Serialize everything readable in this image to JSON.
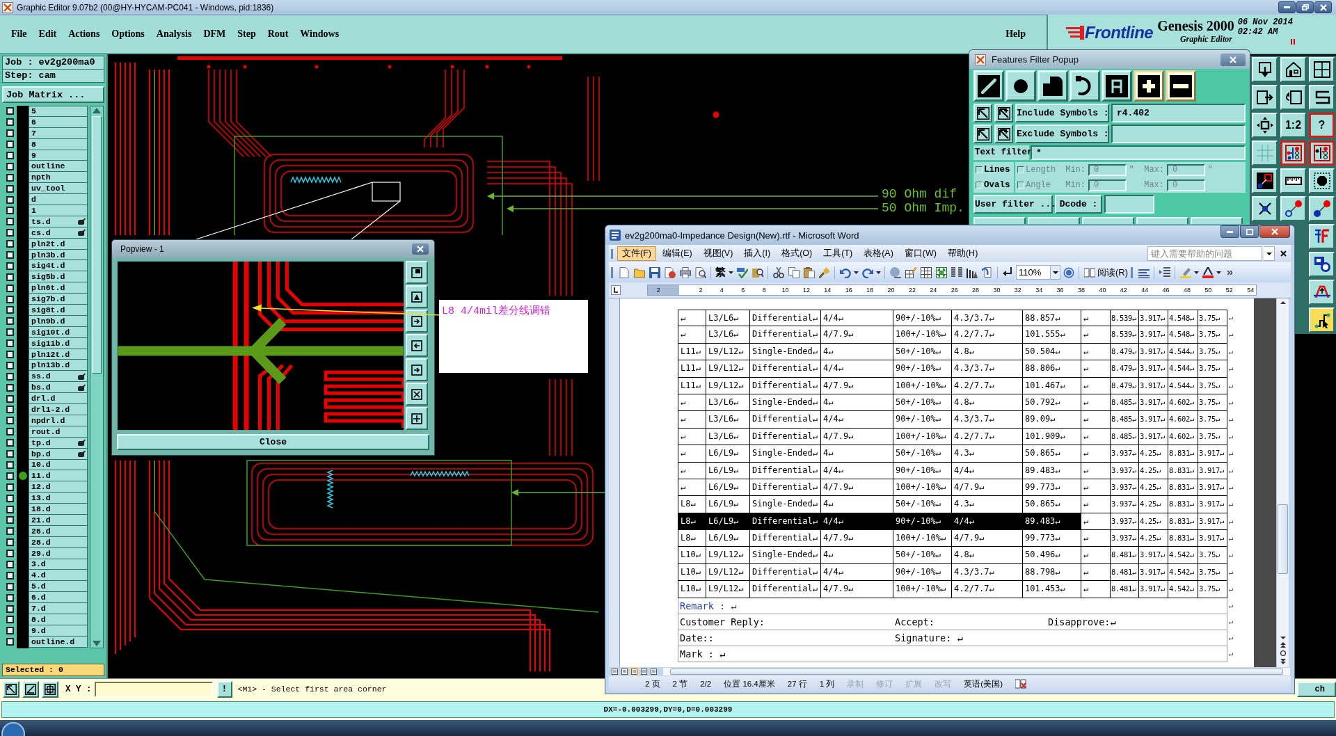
{
  "window": {
    "title": "Graphic Editor 9.07b2 (00@HY-HYCAM-PC041 - Windows, pid:1836)"
  },
  "menu_bar": {
    "items": [
      "File",
      "Edit",
      "Actions",
      "Options",
      "Analysis",
      "DFM",
      "Step",
      "Rout",
      "Windows"
    ],
    "help": "Help"
  },
  "brand": {
    "logo": "Frontline",
    "product": "Genesis 2000",
    "subtitle": "Graphic Editor",
    "date": "06 Nov 2014",
    "time": "02:42 AM"
  },
  "job_panel": {
    "job": "Job : ev2g200ma0",
    "step": "Step: cam",
    "matrix_button": "Job Matrix ...",
    "selected_count": "Selected : 0",
    "layers": [
      {
        "name": "5",
        "checked": false,
        "displayed": false,
        "flagged": false
      },
      {
        "name": "6",
        "checked": false,
        "displayed": false,
        "flagged": false
      },
      {
        "name": "7",
        "checked": false,
        "displayed": false,
        "flagged": false
      },
      {
        "name": "8",
        "checked": false,
        "displayed": false,
        "flagged": false
      },
      {
        "name": "9",
        "checked": false,
        "displayed": false,
        "flagged": false
      },
      {
        "name": "outline",
        "checked": false,
        "displayed": false,
        "flagged": false
      },
      {
        "name": "npth",
        "checked": false,
        "displayed": false,
        "flagged": false
      },
      {
        "name": "uv_tool",
        "checked": false,
        "displayed": false,
        "flagged": false
      },
      {
        "name": "d",
        "checked": false,
        "displayed": false,
        "flagged": false
      },
      {
        "name": "1",
        "checked": false,
        "displayed": false,
        "flagged": false
      },
      {
        "name": "ts.d",
        "checked": false,
        "displayed": false,
        "flagged": true
      },
      {
        "name": "cs.d",
        "checked": false,
        "displayed": false,
        "flagged": true
      },
      {
        "name": "pln2t.d",
        "checked": false,
        "displayed": false,
        "flagged": false
      },
      {
        "name": "pln3b.d",
        "checked": false,
        "displayed": false,
        "flagged": false
      },
      {
        "name": "sig4t.d",
        "checked": false,
        "displayed": false,
        "flagged": false
      },
      {
        "name": "sig5b.d",
        "checked": false,
        "displayed": false,
        "flagged": false
      },
      {
        "name": "pln6t.d",
        "checked": false,
        "displayed": false,
        "flagged": false
      },
      {
        "name": "sig7b.d",
        "checked": false,
        "displayed": false,
        "flagged": false
      },
      {
        "name": "sig8t.d",
        "checked": false,
        "displayed": false,
        "flagged": false
      },
      {
        "name": "pln9b.d",
        "checked": false,
        "displayed": false,
        "flagged": false
      },
      {
        "name": "sig10t.d",
        "checked": false,
        "displayed": false,
        "flagged": false
      },
      {
        "name": "sig11b.d",
        "checked": false,
        "displayed": false,
        "flagged": false
      },
      {
        "name": "pln12t.d",
        "checked": false,
        "displayed": false,
        "flagged": false
      },
      {
        "name": "pln13b.d",
        "checked": false,
        "displayed": false,
        "flagged": false
      },
      {
        "name": "ss.d",
        "checked": false,
        "displayed": false,
        "flagged": true
      },
      {
        "name": "bs.d",
        "checked": false,
        "displayed": false,
        "flagged": true
      },
      {
        "name": "drl.d",
        "checked": false,
        "displayed": false,
        "flagged": false
      },
      {
        "name": "drl1-2.d",
        "checked": false,
        "displayed": false,
        "flagged": false
      },
      {
        "name": "npdrl.d",
        "checked": false,
        "displayed": false,
        "flagged": false
      },
      {
        "name": "rout.d",
        "checked": false,
        "displayed": false,
        "flagged": false
      },
      {
        "name": "tp.d",
        "checked": false,
        "displayed": false,
        "flagged": true
      },
      {
        "name": "bp.d",
        "checked": false,
        "displayed": false,
        "flagged": true
      },
      {
        "name": "10.d",
        "checked": false,
        "displayed": false,
        "flagged": false
      },
      {
        "name": "11.d",
        "checked": false,
        "displayed": true,
        "flagged": false
      },
      {
        "name": "12.d",
        "checked": false,
        "displayed": false,
        "flagged": false
      },
      {
        "name": "13.d",
        "checked": false,
        "displayed": false,
        "flagged": false
      },
      {
        "name": "18.d",
        "checked": false,
        "displayed": false,
        "flagged": false
      },
      {
        "name": "21.d",
        "checked": false,
        "displayed": false,
        "flagged": false
      },
      {
        "name": "26.d",
        "checked": false,
        "displayed": false,
        "flagged": false
      },
      {
        "name": "28.d",
        "checked": false,
        "displayed": false,
        "flagged": false
      },
      {
        "name": "29.d",
        "checked": false,
        "displayed": false,
        "flagged": false
      },
      {
        "name": "3.d",
        "checked": false,
        "displayed": false,
        "flagged": false
      },
      {
        "name": "4.d",
        "checked": false,
        "displayed": false,
        "flagged": false
      },
      {
        "name": "5.d",
        "checked": false,
        "displayed": false,
        "flagged": false
      },
      {
        "name": "6.d",
        "checked": false,
        "displayed": false,
        "flagged": false
      },
      {
        "name": "7.d",
        "checked": false,
        "displayed": false,
        "flagged": false
      },
      {
        "name": "8.d",
        "checked": false,
        "displayed": false,
        "flagged": false
      },
      {
        "name": "9.d",
        "checked": false,
        "displayed": false,
        "flagged": false
      },
      {
        "name": "outline.d",
        "checked": false,
        "displayed": false,
        "flagged": false
      }
    ]
  },
  "canvas": {
    "labels": [
      "90 Ohm dif",
      "50 Ohm Imp."
    ],
    "note": "L8 4/4mil差分线调错"
  },
  "popview": {
    "title": "Popview - 1",
    "close_button": "Close"
  },
  "features_filter": {
    "title": "Features Filter Popup",
    "types": [
      {
        "on": false
      },
      {
        "on": false
      },
      {
        "on": false
      },
      {
        "on": false
      },
      {
        "on": false
      },
      {
        "on": true
      },
      {
        "on": true
      }
    ],
    "include": {
      "label": "Include Symbols :",
      "value": "r4.402"
    },
    "exclude": {
      "label": "Exclude Symbols :"
    },
    "text_filter": {
      "label": "Text filter",
      "value": "*"
    },
    "shapes": [
      {
        "label": "Lines",
        "checked": false
      },
      {
        "label": "Ovals",
        "checked": false
      }
    ],
    "ranges": [
      {
        "label": "Length",
        "checked": false,
        "disabled": true,
        "min_label": "Min:",
        "min": "0",
        "max_label": "Max:",
        "max": "0",
        "unit": "\""
      },
      {
        "label": "Angle",
        "checked": false,
        "disabled": true,
        "min_label": "Min:",
        "min": "0",
        "max_label": "Max:",
        "max": "0"
      }
    ],
    "user_filter_button": "User filter ...",
    "dcode_label": "Dcode :"
  },
  "tool_palette": [
    {
      "on": false,
      "selected": false
    },
    {
      "on": false,
      "selected": false
    },
    {
      "on": false,
      "selected": false
    },
    {
      "on": false,
      "selected": false
    },
    {
      "on": false,
      "selected": false
    },
    {
      "on": false,
      "selected": false
    },
    {
      "on": false,
      "selected": false
    },
    {
      "label": "1:2",
      "on": false,
      "selected": false
    },
    {
      "label": "?",
      "on": true,
      "selected": false
    },
    {
      "on": false,
      "selected": false
    },
    {
      "on": true,
      "selected": false
    },
    {
      "on": true,
      "selected": false
    },
    {
      "on": false,
      "selected": false
    },
    {
      "on": false,
      "selected": false
    },
    {
      "on": false,
      "selected": false
    },
    {
      "on": false,
      "selected": false
    },
    {
      "on": false,
      "selected": false
    },
    {
      "on": false,
      "selected": false
    },
    {
      "on": false,
      "selected": false
    },
    {
      "on": false,
      "selected": false
    },
    {
      "on": false,
      "selected": false
    },
    {
      "on": false,
      "selected": true
    }
  ],
  "word": {
    "title": "ev2g200ma0-Impedance Design(New).rtf - Microsoft Word",
    "menu": [
      {
        "label": "文件(F)",
        "selected": true
      },
      {
        "label": "编辑(E)",
        "selected": false
      },
      {
        "label": "视图(V)",
        "selected": false
      },
      {
        "label": "插入(I)",
        "selected": false
      },
      {
        "label": "格式(O)",
        "selected": false
      },
      {
        "label": "工具(T)",
        "selected": false
      },
      {
        "label": "表格(A)",
        "selected": false
      },
      {
        "label": "窗口(W)",
        "selected": false
      },
      {
        "label": "帮助(H)",
        "selected": false
      }
    ],
    "help_box": {
      "placeholder": "键入需要帮助的问题"
    },
    "toolbar": {
      "script_button": "繁",
      "zoom": "110%",
      "read_button": "阅读(R)"
    },
    "ruler": [
      "2",
      "2",
      "4",
      "6",
      "8",
      "10",
      "12",
      "14",
      "16",
      "18",
      "20",
      "22",
      "24",
      "26",
      "28",
      "30",
      "32",
      "34",
      "36",
      "38",
      "40",
      "42",
      "44",
      "46",
      "48",
      "50",
      "52",
      "54"
    ],
    "table": {
      "rows": [
        {
          "cells": [
            "↵",
            "L3/L6↵",
            "Differential↵",
            "4/4↵",
            "90+/-10%↵",
            "4.3/3.7↵",
            "88.857↵",
            "↵",
            "8.539↵",
            "3.917↵",
            "4.548↵",
            "3.75↵"
          ],
          "end": "↵",
          "selected": false
        },
        {
          "cells": [
            "↵",
            "L3/L6↵",
            "Differential↵",
            "4/7.9↵",
            "100+/-10%↵",
            "4.2/7.7↵",
            "101.555↵",
            "↵",
            "8.539↵",
            "3.917↵",
            "4.548↵",
            "3.75↵"
          ],
          "end": "↵",
          "selected": false
        },
        {
          "cells": [
            "L11↵",
            "L9/L12↵",
            "Single-Ended↵",
            "4↵",
            "50+/-10%↵",
            "4.8↵",
            "50.504↵",
            "↵",
            "8.479↵",
            "3.917↵",
            "4.544↵",
            "3.75↵"
          ],
          "end": "↵",
          "selected": false
        },
        {
          "cells": [
            "L11↵",
            "L9/L12↵",
            "Differential↵",
            "4/4↵",
            "90+/-10%↵",
            "4.3/3.7↵",
            "88.806↵",
            "↵",
            "8.479↵",
            "3.917↵",
            "4.544↵",
            "3.75↵"
          ],
          "end": "↵",
          "selected": false
        },
        {
          "cells": [
            "L11↵",
            "L9/L12↵",
            "Differential↵",
            "4/7.9↵",
            "100+/-10%↵",
            "4.2/7.7↵",
            "101.467↵",
            "↵",
            "8.479↵",
            "3.917↵",
            "4.544↵",
            "3.75↵"
          ],
          "end": "↵",
          "selected": false
        },
        {
          "cells": [
            "↵",
            "L3/L6↵",
            "Single-Ended↵",
            "4↵",
            "50+/-10%↵",
            "4.8↵",
            "50.792↵",
            "↵",
            "8.485↵",
            "3.917↵",
            "4.602↵",
            "3.75↵"
          ],
          "end": "↵",
          "selected": false
        },
        {
          "cells": [
            "↵",
            "L3/L6↵",
            "Differential↵",
            "4/4↵",
            "90+/-10%↵",
            "4.3/3.7↵",
            "89.09↵",
            "↵",
            "8.485↵",
            "3.917↵",
            "4.602↵",
            "3.75↵"
          ],
          "end": "↵",
          "selected": false
        },
        {
          "cells": [
            "↵",
            "L3/L6↵",
            "Differential↵",
            "4/7.9↵",
            "100+/-10%↵",
            "4.2/7.7↵",
            "101.909↵",
            "↵",
            "8.485↵",
            "3.917↵",
            "4.602↵",
            "3.75↵"
          ],
          "end": "↵",
          "selected": false
        },
        {
          "cells": [
            "↵",
            "L6/L9↵",
            "Single-Ended↵",
            "4↵",
            "50+/-10%↵",
            "4.3↵",
            "50.865↵",
            "↵",
            "3.937↵",
            "4.25↵",
            "8.831↵",
            "3.917↵"
          ],
          "end": "↵",
          "selected": false
        },
        {
          "cells": [
            "↵",
            "L6/L9↵",
            "Differential↵",
            "4/4↵",
            "90+/-10%↵",
            "4/4↵",
            "89.483↵",
            "↵",
            "3.937↵",
            "4.25↵",
            "8.831↵",
            "3.917↵"
          ],
          "end": "↵",
          "selected": false
        },
        {
          "cells": [
            "↵",
            "L6/L9↵",
            "Differential↵",
            "4/7.9↵",
            "100+/-10%↵",
            "4/7.9↵",
            "99.773↵",
            "↵",
            "3.937↵",
            "4.25↵",
            "8.831↵",
            "3.917↵"
          ],
          "end": "↵",
          "selected": false
        },
        {
          "cells": [
            "L8↵",
            "L6/L9↵",
            "Single-Ended↵",
            "4↵",
            "50+/-10%↵",
            "4.3↵",
            "50.865↵",
            "↵",
            "3.937↵",
            "4.25↵",
            "8.831↵",
            "3.917↵"
          ],
          "end": "↵",
          "selected": false
        },
        {
          "cells": [
            "L8↵",
            "L6/L9↵",
            "Differential↵",
            "4/4↵",
            "90+/-10%↵",
            "4/4↵",
            "89.483↵",
            "↵",
            "3.937↵",
            "4.25↵",
            "8.831↵",
            "3.917↵"
          ],
          "end": "↵",
          "selected": true
        },
        {
          "cells": [
            "L8↵",
            "L6/L9↵",
            "Differential↵",
            "4/7.9↵",
            "100+/-10%↵",
            "4/7.9↵",
            "99.773↵",
            "↵",
            "3.937↵",
            "4.25↵",
            "8.831↵",
            "3.917↵"
          ],
          "end": "↵",
          "selected": false
        },
        {
          "cells": [
            "L10↵",
            "L9/L12↵",
            "Single-Ended↵",
            "4↵",
            "50+/-10%↵",
            "4.8↵",
            "50.496↵",
            "↵",
            "8.481↵",
            "3.917↵",
            "4.542↵",
            "3.75↵"
          ],
          "end": "↵",
          "selected": false
        },
        {
          "cells": [
            "L10↵",
            "L9/L12↵",
            "Differential↵",
            "4/4↵",
            "90+/-10%↵",
            "4.3/3.7↵",
            "88.798↵",
            "↵",
            "8.481↵",
            "3.917↵",
            "4.542↵",
            "3.75↵"
          ],
          "end": "↵",
          "selected": false
        },
        {
          "cells": [
            "L10↵",
            "L9/L12↵",
            "Differential↵",
            "4/7.9↵",
            "100+/-10%↵",
            "4.2/7.7↵",
            "101.453↵",
            "↵",
            "8.481↵",
            "3.917↵",
            "4.542↵",
            "3.75↵"
          ],
          "end": "↵",
          "selected": false
        }
      ]
    },
    "footer": [
      {
        "kind": "remark",
        "cells": [
          "Remark : ↵"
        ],
        "end": "↵"
      },
      {
        "kind": "field",
        "cells": [
          "Customer Reply:",
          "Accept:",
          "Disapprove:↵"
        ],
        "end": "↵"
      },
      {
        "kind": "field",
        "cells": [
          "Date::",
          "Signature: ↵"
        ],
        "end": "↵"
      },
      {
        "kind": "field",
        "cells": [
          "Mark : ↵"
        ],
        "end": "↵"
      }
    ],
    "status": [
      {
        "text": "2 页",
        "disabled": false
      },
      {
        "text": "2 节",
        "disabled": false
      },
      {
        "text": "2/2",
        "disabled": false
      },
      {
        "text": "位置 16.4厘米",
        "disabled": false
      },
      {
        "text": "27 行",
        "disabled": false
      },
      {
        "text": "1 列",
        "disabled": false
      },
      {
        "text": "录制",
        "disabled": true
      },
      {
        "text": "修订",
        "disabled": true
      },
      {
        "text": "扩展",
        "disabled": true
      },
      {
        "text": "改写",
        "disabled": true
      },
      {
        "text": "英语(美国)",
        "disabled": false
      }
    ]
  },
  "command_bar": {
    "xy_label": "X Y :",
    "bang_button": "!",
    "message": "<M1> - Select first area corner",
    "partial_button": "ch"
  },
  "status_line": "DX=-0.003299,DY=0,D=0.003299"
}
